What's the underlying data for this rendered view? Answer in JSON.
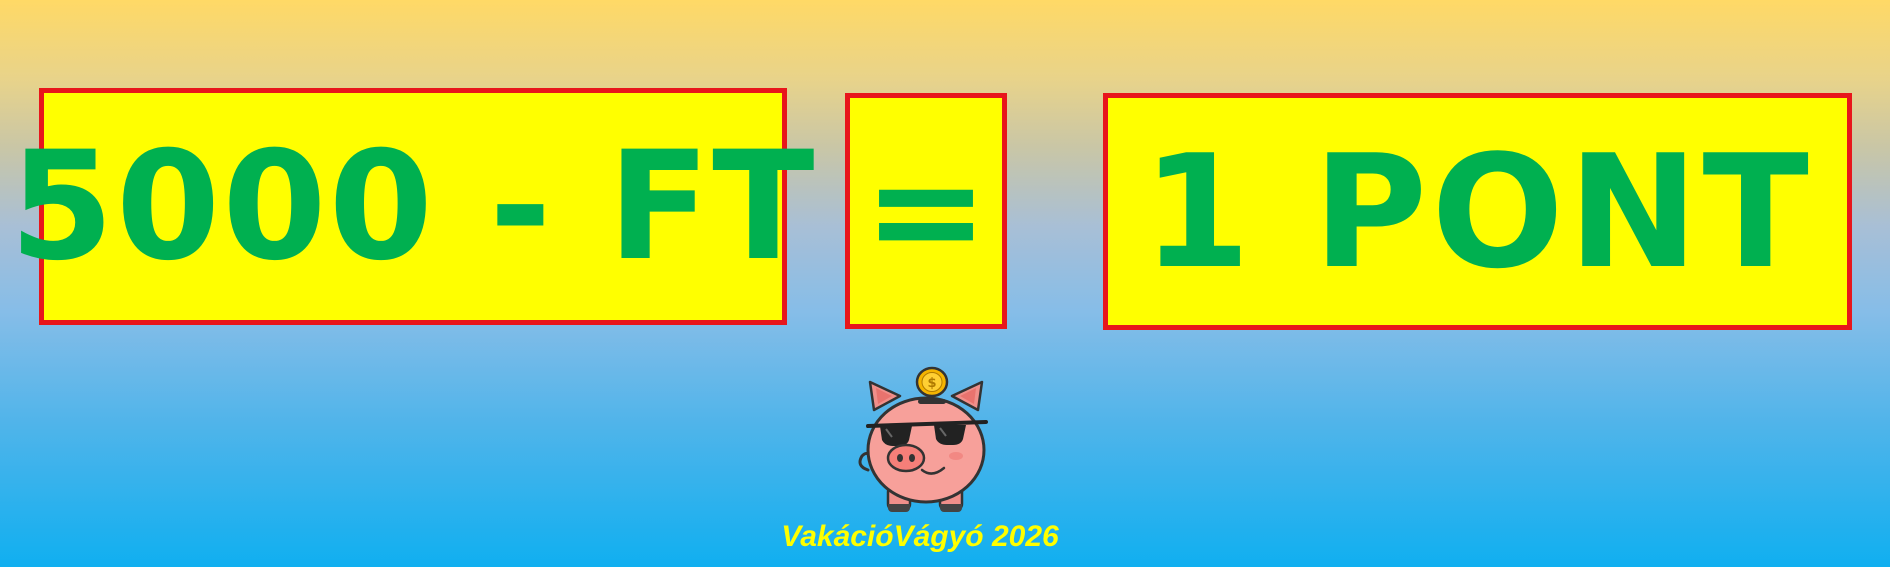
{
  "left_box": {
    "text": "5000 - FT"
  },
  "equals_box": {
    "text": "="
  },
  "right_box": {
    "text": "1 PONT"
  },
  "footer": {
    "text": "VakációVágyó 2026"
  },
  "mascot": {
    "icon": "piggy-bank-with-sunglasses-icon",
    "coin_symbol": "$"
  },
  "colors": {
    "box_fill": "#ffff00",
    "box_border": "#e8161b",
    "text_green": "#00b050",
    "footer_text": "#ffff00",
    "background_top": "#ffd966",
    "background_bottom": "#10aff0"
  }
}
